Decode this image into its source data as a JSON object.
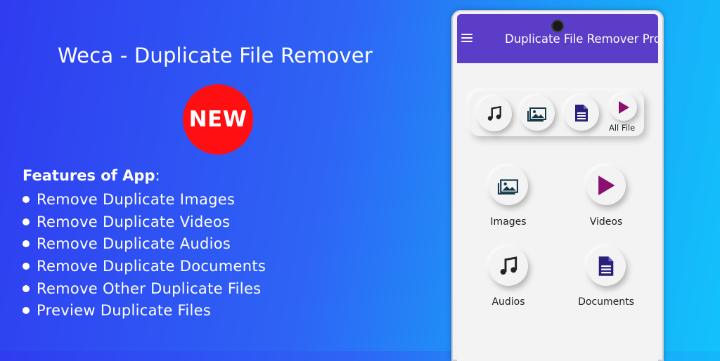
{
  "promo": {
    "title": "Weca - Duplicate File Remover",
    "badge": "NEW"
  },
  "features": {
    "title": "Features of App",
    "colon": ":",
    "items": [
      "Remove Duplicate Images",
      "Remove Duplicate Videos",
      "Remove Duplicate Audios",
      "Remove Duplicate Documents",
      "Remove Other Duplicate Files",
      "Preview Duplicate Files"
    ]
  },
  "app": {
    "title": "Duplicate File Remover Pro",
    "quick_bar": {
      "all_file_label": "All File"
    },
    "grid": {
      "images": "Images",
      "videos": "Videos",
      "audios": "Audios",
      "documents": "Documents"
    }
  },
  "colors": {
    "app_bar": "#5b3dc8",
    "badge": "#ff0f12",
    "play_icon": "#8a0f6e",
    "document_icon": "#2a1f7a"
  },
  "icons": {
    "menu": "hamburger-menu-icon",
    "music": "music-note-icon",
    "image": "image-gallery-icon",
    "document": "document-icon",
    "play": "play-icon"
  }
}
